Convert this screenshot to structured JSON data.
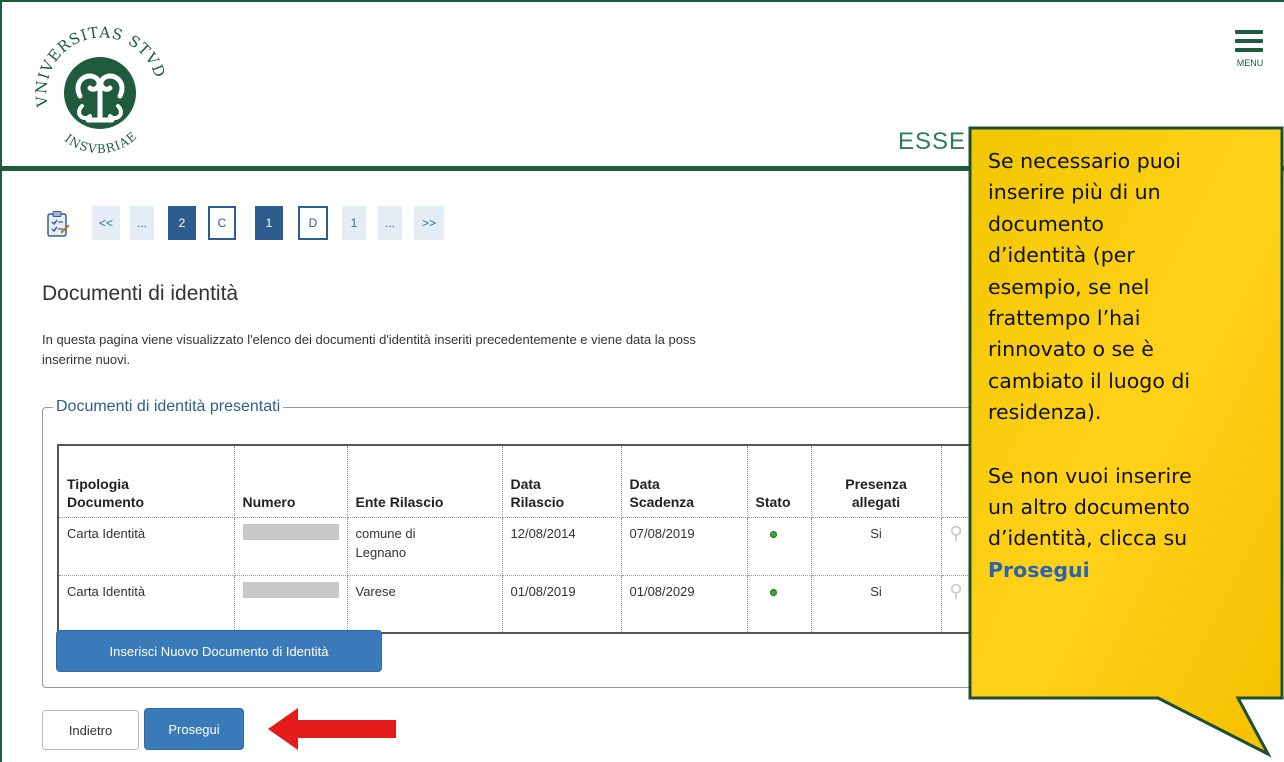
{
  "header": {
    "logo_text": "UNIVERSITAS STUDIORUM INSUBRIAE",
    "menu_label": "MENU",
    "section_title": "ESSE"
  },
  "pager": {
    "items": [
      {
        "label": "<<",
        "style": "light"
      },
      {
        "label": "...",
        "style": "light"
      },
      {
        "label": "2",
        "style": "dark"
      },
      {
        "label": "C",
        "style": "outline"
      },
      {
        "label": "1",
        "style": "dark"
      },
      {
        "label": "D",
        "style": "outline"
      },
      {
        "label": "1",
        "style": "light"
      },
      {
        "label": "...",
        "style": "light"
      },
      {
        "label": ">>",
        "style": "light"
      }
    ]
  },
  "page": {
    "title": "Documenti di identità",
    "intro_line1": "In questa pagina viene visualizzato l'elenco dei documenti d'identità inseriti precedentemente e viene data la poss",
    "intro_line2": "inserirne nuovi."
  },
  "docs": {
    "legend": "Documenti di identità presentati",
    "headers": {
      "tipologia_1": "Tipologia",
      "tipologia_2": "Documento",
      "numero": "Numero",
      "ente": "Ente Rilascio",
      "rilascio_1": "Data",
      "rilascio_2": "Rilascio",
      "scadenza_1": "Data",
      "scadenza_2": "Scadenza",
      "stato": "Stato",
      "allegati_1": "Presenza",
      "allegati_2": "allegati"
    },
    "rows": [
      {
        "tipologia": "Carta Identità",
        "ente_1": "comune di",
        "ente_2": "Legnano",
        "rilascio": "12/08/2014",
        "scadenza": "07/08/2019",
        "stato_color": "#3aa33a",
        "allegati": "Si"
      },
      {
        "tipologia": "Carta Identità",
        "ente_1": "Varese",
        "ente_2": "",
        "rilascio": "01/08/2019",
        "scadenza": "01/08/2029",
        "stato_color": "#3aa33a",
        "allegati": "Si"
      }
    ],
    "new_button": "Inserisci Nuovo Documento di Identità"
  },
  "nav": {
    "back_label": "Indietro",
    "next_label": "Prosegui"
  },
  "callout": {
    "p1_l1": "Se necessario puoi",
    "p1_l2": "inserire più di un",
    "p1_l3": "documento",
    "p1_l4": "d’identità (per",
    "p1_l5": "esempio, se nel",
    "p1_l6": "frattempo l’hai",
    "p1_l7": "rinnovato o se è",
    "p1_l8": "cambiato il luogo di",
    "p1_l9": "residenza).",
    "p2_l1": "Se non vuoi inserire",
    "p2_l2": "un altro documento",
    "p2_l3": "d’identità, clicca su",
    "p2_highlight": "Prosegui"
  },
  "colors": {
    "brand_green": "#1f5c3e",
    "title_green": "#2d7d5b",
    "primary_blue": "#3a7ab8",
    "pager_dark": "#2d5d8f",
    "callout_yellow": "#f2c200",
    "arrow_red": "#e31b1b"
  }
}
